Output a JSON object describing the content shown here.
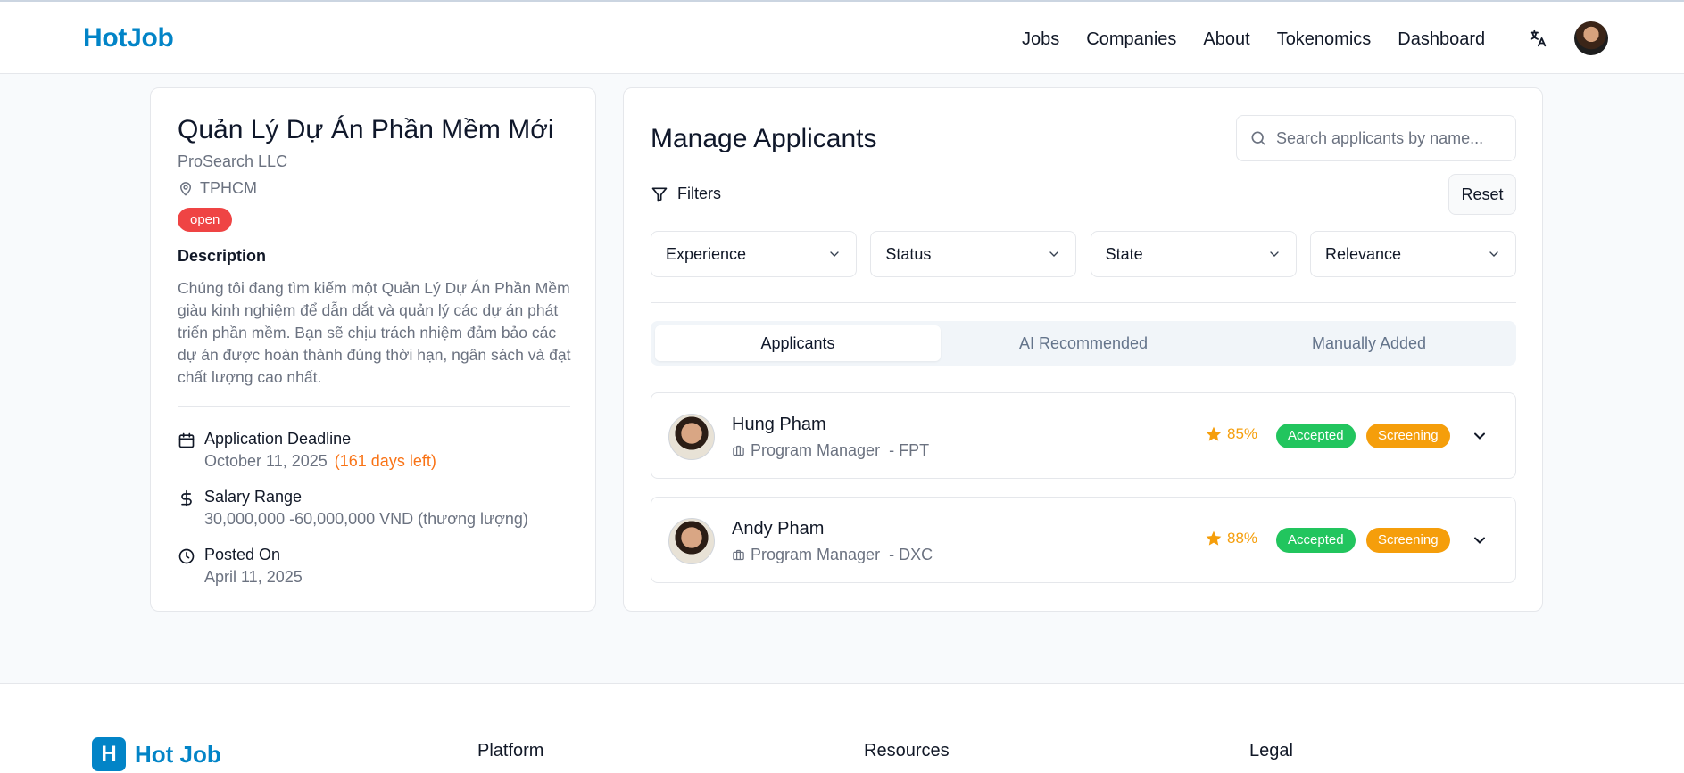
{
  "header": {
    "logo": "HotJob",
    "nav": [
      "Jobs",
      "Companies",
      "About",
      "Tokenomics",
      "Dashboard"
    ],
    "icons": {
      "language": "translate-icon",
      "user": "avatar"
    }
  },
  "job": {
    "title": "Quản Lý Dự Án Phần Mềm Mới",
    "company": "ProSearch LLC",
    "location": "TPHCM",
    "status": "open",
    "description_heading": "Description",
    "description": "Chúng tôi đang tìm kiếm một Quản Lý Dự Án Phần Mềm giàu kinh nghiệm để dẫn dắt và quản lý các dự án phát triển phần mềm. Bạn sẽ chịu trách nhiệm đảm bảo các dự án được hoàn thành đúng thời hạn, ngân sách và đạt chất lượng cao nhất.",
    "deadline_label": "Application Deadline",
    "deadline_value": "October 11, 2025",
    "deadline_left": "(161 days left)",
    "salary_label": "Salary Range",
    "salary_value": "30,000,000 -60,000,000 VND (thương lượng)",
    "posted_label": "Posted On",
    "posted_value": "April 11, 2025"
  },
  "manage": {
    "title": "Manage Applicants",
    "search_placeholder": "Search applicants by name...",
    "filters_label": "Filters",
    "reset_label": "Reset",
    "selects": [
      "Experience",
      "Status",
      "State",
      "Relevance"
    ],
    "tabs": [
      "Applicants",
      "AI Recommended",
      "Manually Added"
    ],
    "active_tab": 0,
    "applicants": [
      {
        "name": "Hung Pham",
        "role": "Program Manager",
        "company": "- FPT",
        "score": "85%",
        "status": "Accepted",
        "stage": "Screening"
      },
      {
        "name": "Andy Pham",
        "role": "Program Manager",
        "company": "- DXC",
        "score": "88%",
        "status": "Accepted",
        "stage": "Screening"
      }
    ]
  },
  "footer": {
    "logo_mark": "H",
    "logo_text": "Hot Job",
    "columns": [
      "Platform",
      "Resources",
      "Legal"
    ]
  },
  "colors": {
    "brand": "#0284c7",
    "open": "#ef4444",
    "accepted": "#22c55e",
    "screening": "#f59e0b",
    "days_left": "#f97316"
  }
}
